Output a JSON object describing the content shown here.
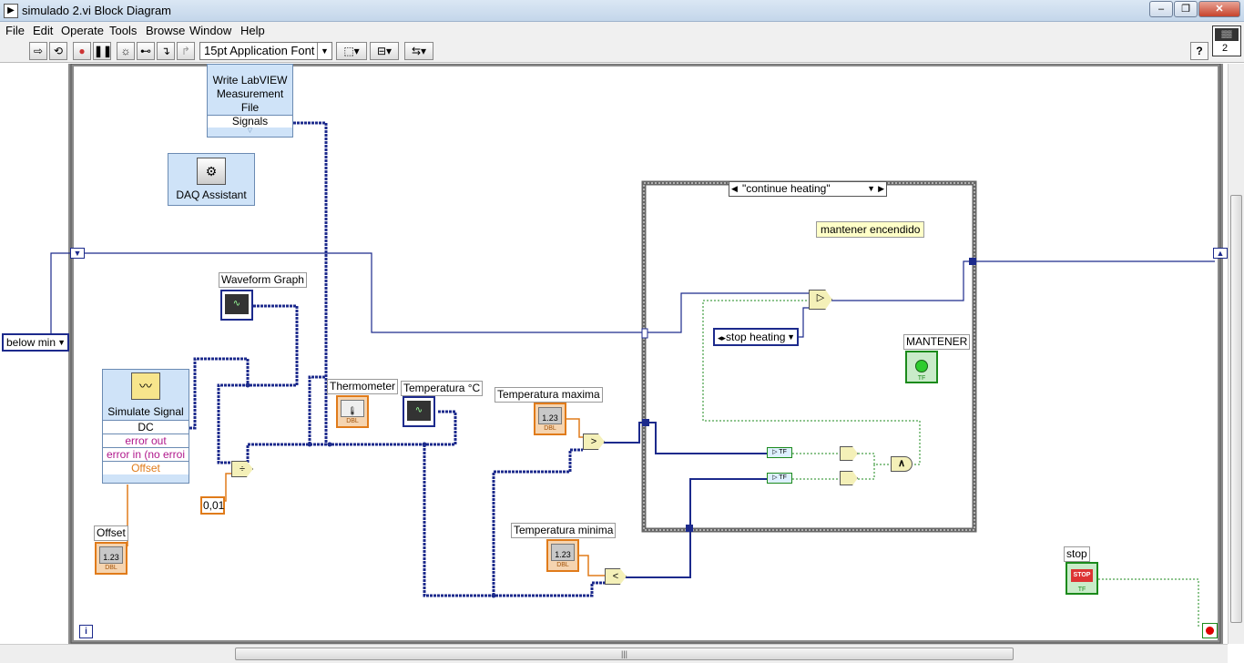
{
  "window": {
    "title": "simulado 2.vi Block Diagram"
  },
  "menu": [
    "File",
    "Edit",
    "Operate",
    "Tools",
    "Browse",
    "Window",
    "Help"
  ],
  "toolbar": {
    "font": "15pt Application Font",
    "connector_number": "2"
  },
  "controls": {
    "enum_left": "below min",
    "case_selector": "\"continue heating\"",
    "enum_inner": "stop heating",
    "constant": "0,01"
  },
  "nodes": {
    "write_file": {
      "line1": "Write LabVIEW",
      "line2": "Measurement",
      "line3": "File",
      "port": "Signals"
    },
    "daq": "DAQ Assistant",
    "simulate": {
      "title": "Simulate Signal",
      "dc": "DC",
      "error_out": "error out",
      "error_in": "error in (no erroi",
      "offset": "Offset"
    }
  },
  "labels": {
    "waveform_graph": "Waveform Graph",
    "thermometer": "Thermometer",
    "temperatura": "Temperatura °C",
    "temp_max": "Temperatura maxima",
    "temp_min": "Temperatura minima",
    "offset": "Offset",
    "mantener": "MANTENER",
    "stop": "stop",
    "comment": "mantener encendido"
  },
  "terminal_tags": {
    "dbl": "DBL",
    "tf": "TF",
    "num": "1.23",
    "stop_btn": "STOP"
  }
}
